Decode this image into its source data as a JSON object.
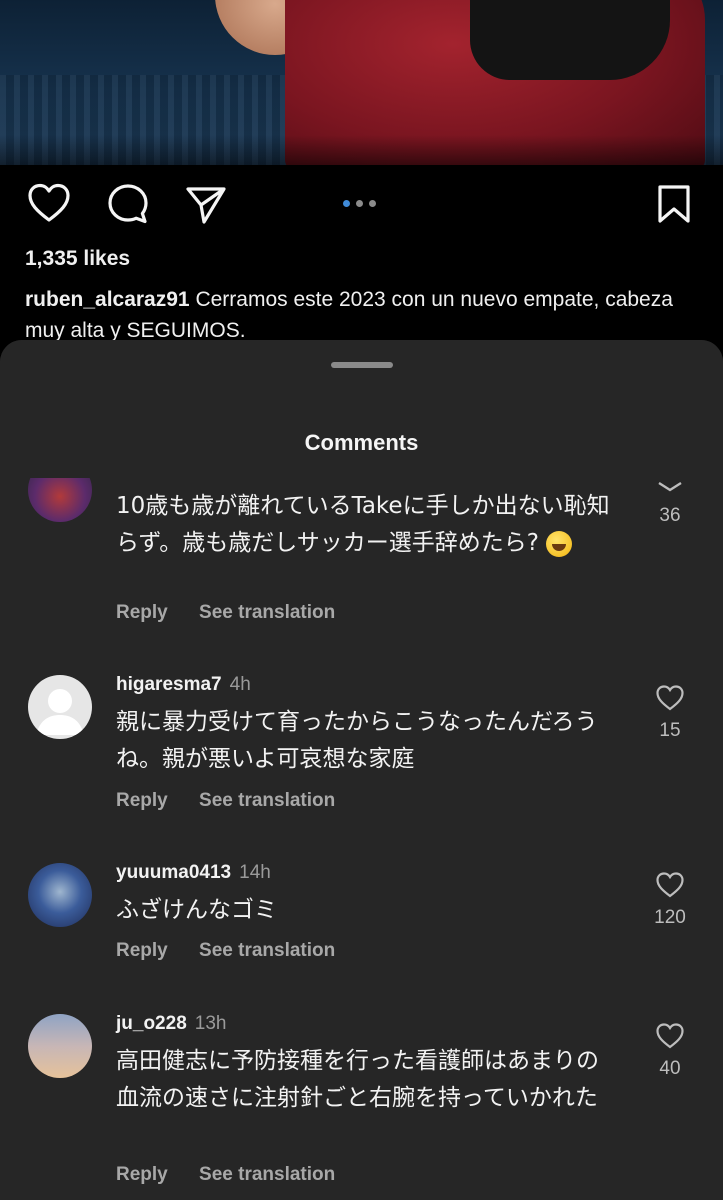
{
  "post": {
    "likes": "1,335 likes",
    "caption_user": "ruben_alcaraz91",
    "caption_text": "Cerramos este 2023 con un nuevo empate, cabeza muy alta y SEGUIMOS."
  },
  "icons": {
    "like": "heart-icon",
    "comment": "comment-icon",
    "share": "send-icon",
    "save": "bookmark-icon",
    "carousel": "carousel-dots"
  },
  "comments_sheet": {
    "title": "Comments",
    "comments": [
      {
        "username": "",
        "time": "",
        "text": "10歳も歳が離れているTakeに手しか出ない恥知らず。歳も歳だしサッカー選手辞めたら?",
        "emoji": "rolling-on-the-floor-laughing",
        "likes": "36",
        "reply": "Reply",
        "translate": "See translation"
      },
      {
        "username": "higaresma7",
        "time": "4h",
        "text": "親に暴力受けて育ったからこうなったんだろうね。親が悪いよ可哀想な家庭",
        "likes": "15",
        "reply": "Reply",
        "translate": "See translation"
      },
      {
        "username": "yuuuma0413",
        "time": "14h",
        "text": "ふざけんなゴミ",
        "likes": "120",
        "reply": "Reply",
        "translate": "See translation"
      },
      {
        "username": "ju_o228",
        "time": "13h",
        "text": "高田健志に予防接種を行った看護師はあまりの血流の速さに注射針ごと右腕を持っていかれた",
        "likes": "40",
        "reply": "Reply",
        "translate": "See translation"
      }
    ]
  },
  "colors": {
    "background": "#000000",
    "sheet": "#262626",
    "active_dot": "#3f8ad8",
    "muted_text": "#a8a8a8"
  }
}
